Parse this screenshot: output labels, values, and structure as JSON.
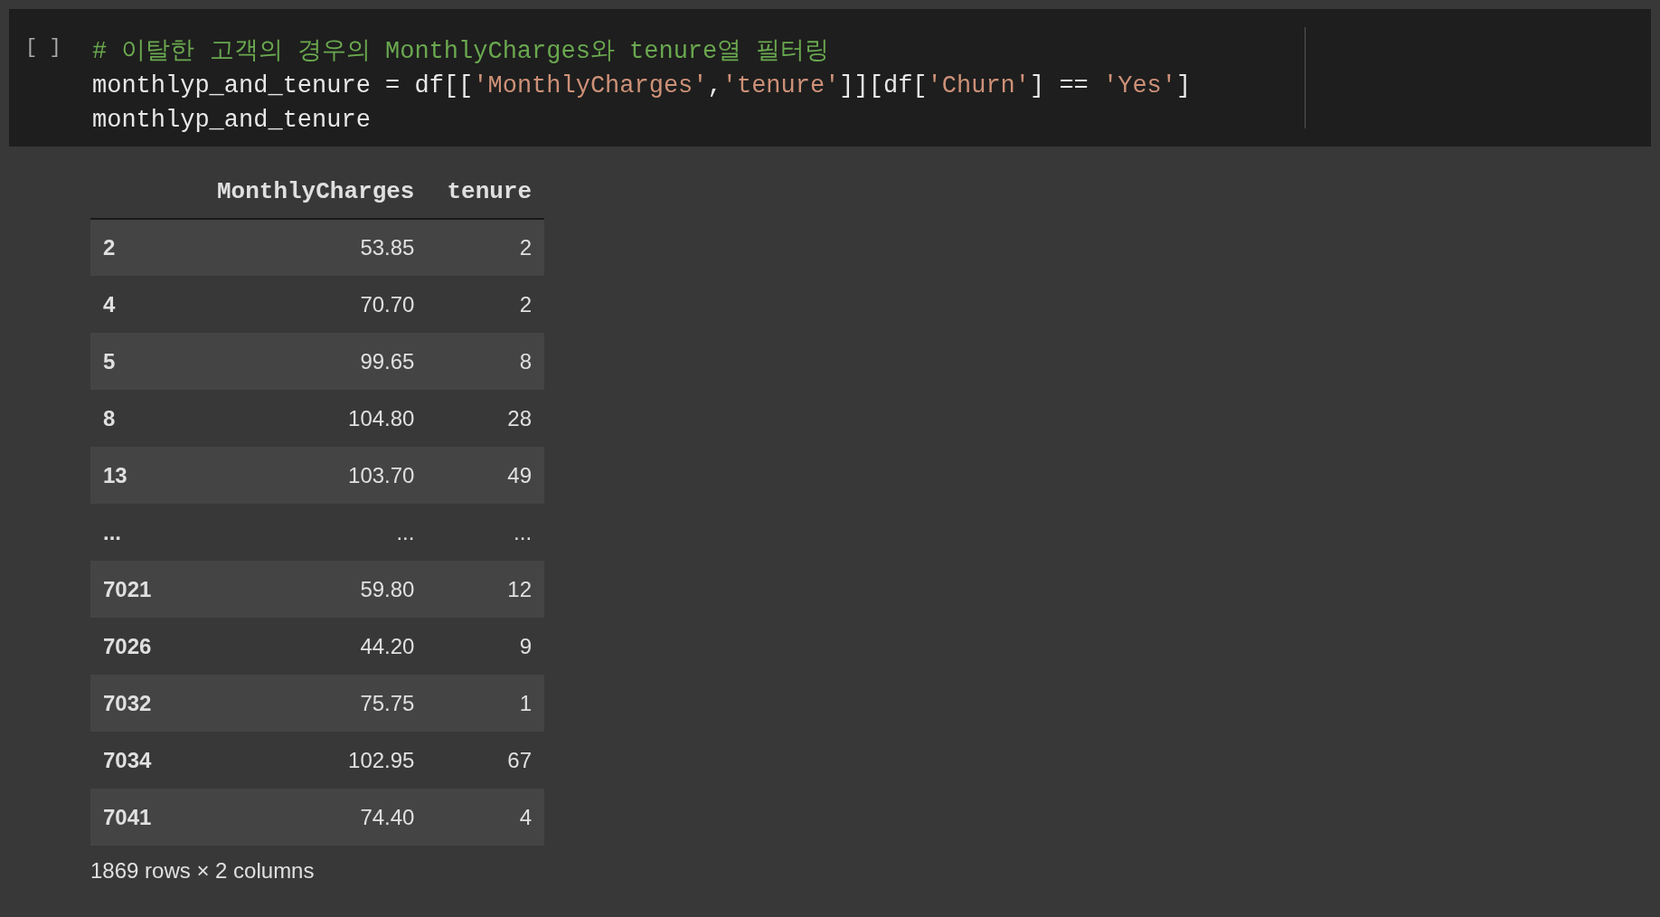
{
  "cell": {
    "prompt": "[ ]",
    "code_lines": [
      [
        {
          "kind": "comment",
          "text": "# 이탈한 고객의 경우의 MonthlyCharges와 tenure열 필터링"
        }
      ],
      [
        {
          "kind": "plain",
          "text": "monthlyp_and_tenure = df[["
        },
        {
          "kind": "string",
          "text": "'MonthlyCharges'"
        },
        {
          "kind": "plain",
          "text": ","
        },
        {
          "kind": "string",
          "text": "'tenure'"
        },
        {
          "kind": "plain",
          "text": "]][df["
        },
        {
          "kind": "string",
          "text": "'Churn'"
        },
        {
          "kind": "plain",
          "text": "] == "
        },
        {
          "kind": "string",
          "text": "'Yes'"
        },
        {
          "kind": "plain",
          "text": "]"
        }
      ],
      [
        {
          "kind": "plain",
          "text": "monthlyp_and_tenure"
        }
      ]
    ]
  },
  "table": {
    "columns": [
      "MonthlyCharges",
      "tenure"
    ],
    "rows": [
      {
        "index": "2",
        "values": [
          "53.85",
          "2"
        ]
      },
      {
        "index": "4",
        "values": [
          "70.70",
          "2"
        ]
      },
      {
        "index": "5",
        "values": [
          "99.65",
          "8"
        ]
      },
      {
        "index": "8",
        "values": [
          "104.80",
          "28"
        ]
      },
      {
        "index": "13",
        "values": [
          "103.70",
          "49"
        ]
      },
      {
        "index": "...",
        "values": [
          "...",
          "..."
        ]
      },
      {
        "index": "7021",
        "values": [
          "59.80",
          "12"
        ]
      },
      {
        "index": "7026",
        "values": [
          "44.20",
          "9"
        ]
      },
      {
        "index": "7032",
        "values": [
          "75.75",
          "1"
        ]
      },
      {
        "index": "7034",
        "values": [
          "102.95",
          "67"
        ]
      },
      {
        "index": "7041",
        "values": [
          "74.40",
          "4"
        ]
      }
    ]
  },
  "footer": "1869 rows × 2 columns"
}
